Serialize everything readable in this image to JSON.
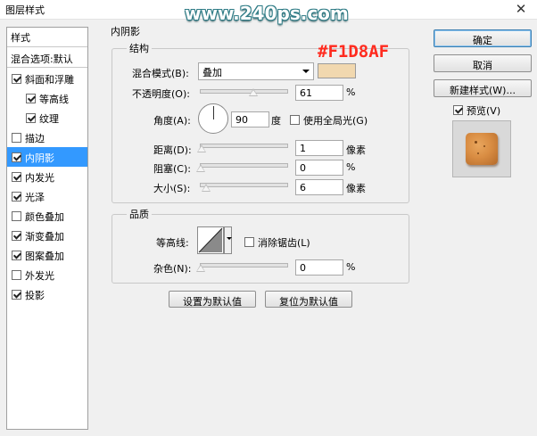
{
  "window": {
    "title": "图层样式",
    "close_glyph": "✕"
  },
  "overlay": {
    "watermark": "www.240ps.com",
    "color_code": "#F1D8AF"
  },
  "styles_panel": {
    "header": "样式",
    "blend_options": "混合选项:默认",
    "items": [
      {
        "label": "斜面和浮雕",
        "checked": true,
        "indent": false,
        "selected": false
      },
      {
        "label": "等高线",
        "checked": true,
        "indent": true,
        "selected": false
      },
      {
        "label": "纹理",
        "checked": true,
        "indent": true,
        "selected": false
      },
      {
        "label": "描边",
        "checked": false,
        "indent": false,
        "selected": false
      },
      {
        "label": "内阴影",
        "checked": true,
        "indent": false,
        "selected": true
      },
      {
        "label": "内发光",
        "checked": true,
        "indent": false,
        "selected": false
      },
      {
        "label": "光泽",
        "checked": true,
        "indent": false,
        "selected": false
      },
      {
        "label": "颜色叠加",
        "checked": false,
        "indent": false,
        "selected": false
      },
      {
        "label": "渐变叠加",
        "checked": true,
        "indent": false,
        "selected": false
      },
      {
        "label": "图案叠加",
        "checked": true,
        "indent": false,
        "selected": false
      },
      {
        "label": "外发光",
        "checked": false,
        "indent": false,
        "selected": false
      },
      {
        "label": "投影",
        "checked": true,
        "indent": false,
        "selected": false
      }
    ]
  },
  "inner_shadow": {
    "section_title": "内阴影",
    "structure": {
      "title": "结构",
      "blend_mode_label": "混合模式(B):",
      "blend_mode_value": "叠加",
      "color": "#F1D8AF",
      "opacity_label": "不透明度(O):",
      "opacity_value": "61",
      "opacity_unit": "%",
      "opacity_fraction": 0.61,
      "angle_label": "角度(A):",
      "angle_value": "90",
      "angle_unit": "度",
      "global_light_label": "使用全局光(G)",
      "global_light_checked": false,
      "distance_label": "距离(D):",
      "distance_value": "1",
      "distance_unit": "像素",
      "choke_label": "阻塞(C):",
      "choke_value": "0",
      "choke_unit": "%",
      "size_label": "大小(S):",
      "size_value": "6",
      "size_unit": "像素"
    },
    "quality": {
      "title": "品质",
      "contour_label": "等高线:",
      "antialias_label": "消除锯齿(L)",
      "antialias_checked": false,
      "noise_label": "杂色(N):",
      "noise_value": "0",
      "noise_unit": "%"
    },
    "make_default": "设置为默认值",
    "reset_default": "复位为默认值"
  },
  "actions": {
    "ok": "确定",
    "cancel": "取消",
    "new_style": "新建样式(W)...",
    "preview_label": "预览(V)",
    "preview_checked": true
  }
}
